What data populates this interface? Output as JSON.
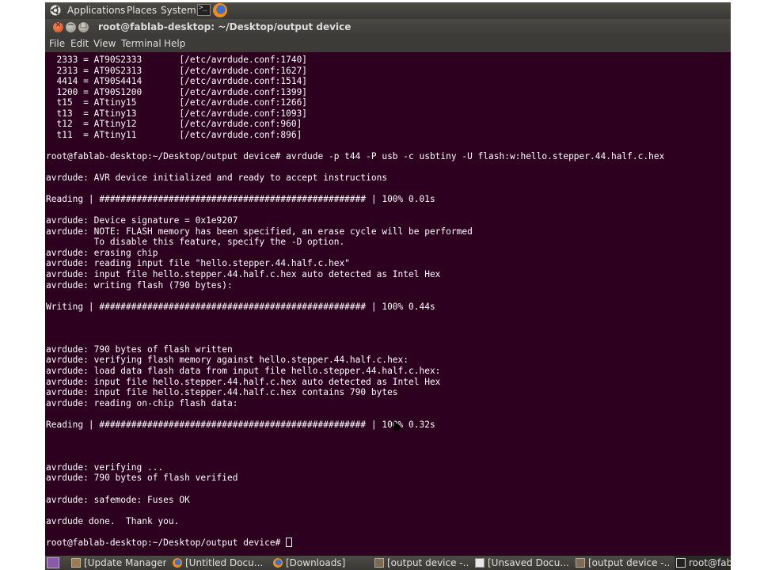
{
  "panel": {
    "menus": [
      "Applications",
      "Places",
      "System"
    ],
    "launchers": [
      "terminal-icon",
      "firefox-icon"
    ]
  },
  "window": {
    "title": "root@fablab-desktop: ~/Desktop/output device",
    "buttons": {
      "close": "×",
      "minimize": "−",
      "maximize": "□"
    },
    "menu": [
      "File",
      "Edit",
      "View",
      "Terminal",
      "Help"
    ]
  },
  "terminal": {
    "lines": [
      "  2333 = AT90S2333       [/etc/avrdude.conf:1740]",
      "  2313 = AT90S2313       [/etc/avrdude.conf:1627]",
      "  4414 = AT90S4414       [/etc/avrdude.conf:1514]",
      "  1200 = AT90S1200       [/etc/avrdude.conf:1399]",
      "  t15  = ATtiny15        [/etc/avrdude.conf:1266]",
      "  t13  = ATtiny13        [/etc/avrdude.conf:1093]",
      "  t12  = ATtiny12        [/etc/avrdude.conf:960]",
      "  t11  = ATtiny11        [/etc/avrdude.conf:896]",
      "",
      "root@fablab-desktop:~/Desktop/output device# avrdude -p t44 -P usb -c usbtiny -U flash:w:hello.stepper.44.half.c.hex",
      "",
      "avrdude: AVR device initialized and ready to accept instructions",
      "",
      "Reading | ################################################## | 100% 0.01s",
      "",
      "avrdude: Device signature = 0x1e9207",
      "avrdude: NOTE: FLASH memory has been specified, an erase cycle will be performed",
      "         To disable this feature, specify the -D option.",
      "avrdude: erasing chip",
      "avrdude: reading input file \"hello.stepper.44.half.c.hex\"",
      "avrdude: input file hello.stepper.44.half.c.hex auto detected as Intel Hex",
      "avrdude: writing flash (790 bytes):",
      "",
      "Writing | ################################################## | 100% 0.44s",
      "",
      "",
      "",
      "avrdude: 790 bytes of flash written",
      "avrdude: verifying flash memory against hello.stepper.44.half.c.hex:",
      "avrdude: load data flash data from input file hello.stepper.44.half.c.hex:",
      "avrdude: input file hello.stepper.44.half.c.hex auto detected as Intel Hex",
      "avrdude: input file hello.stepper.44.half.c.hex contains 790 bytes",
      "avrdude: reading on-chip flash data:",
      "",
      "Reading | ################################################## | 100% 0.32s",
      "",
      "",
      "",
      "avrdude: verifying ...",
      "avrdude: 790 bytes of flash verified",
      "",
      "avrdude: safemode: Fuses OK",
      "",
      "avrdude done.  Thank you.",
      "",
      "root@fablab-desktop:~/Desktop/output device# "
    ]
  },
  "taskbar": {
    "tasks": [
      {
        "label": "[Update Manager]",
        "icon": "package-icon",
        "active": false
      },
      {
        "label": "[Untitled Docu...",
        "icon": "firefox-icon",
        "active": false
      },
      {
        "label": "[Downloads]",
        "icon": "firefox-icon",
        "active": false
      },
      {
        "label": "[output device -...",
        "icon": "folder-icon",
        "active": false
      },
      {
        "label": "[Unsaved Docu...",
        "icon": "document-icon",
        "active": false
      },
      {
        "label": "[output device -...",
        "icon": "folder-icon",
        "active": false
      },
      {
        "label": "root@fab",
        "icon": "terminal-icon",
        "active": true
      }
    ]
  }
}
